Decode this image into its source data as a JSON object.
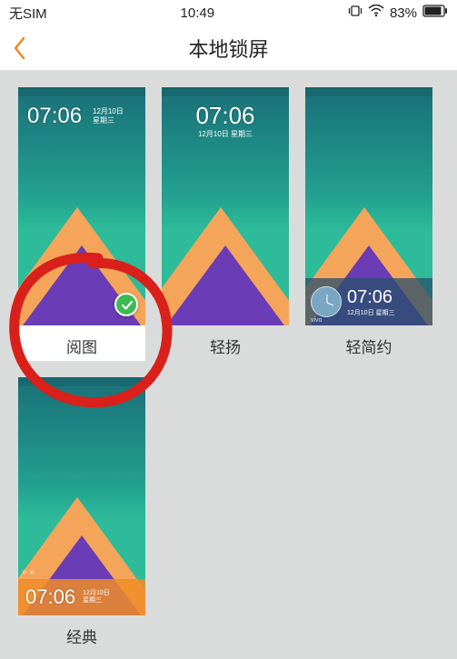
{
  "status": {
    "sim": "无SIM",
    "time": "10:49",
    "battery": "83%"
  },
  "header": {
    "title": "本地锁屏"
  },
  "lock_preview": {
    "time": "07:06",
    "date_line1": "12月10日",
    "date_line2": "星期三",
    "date_combined": "12月10日  星期三",
    "brand": "vivo"
  },
  "themes": [
    {
      "label": "阅图",
      "selected": true
    },
    {
      "label": "轻扬",
      "selected": false
    },
    {
      "label": "轻简约",
      "selected": false
    },
    {
      "label": "经典",
      "selected": false
    }
  ]
}
